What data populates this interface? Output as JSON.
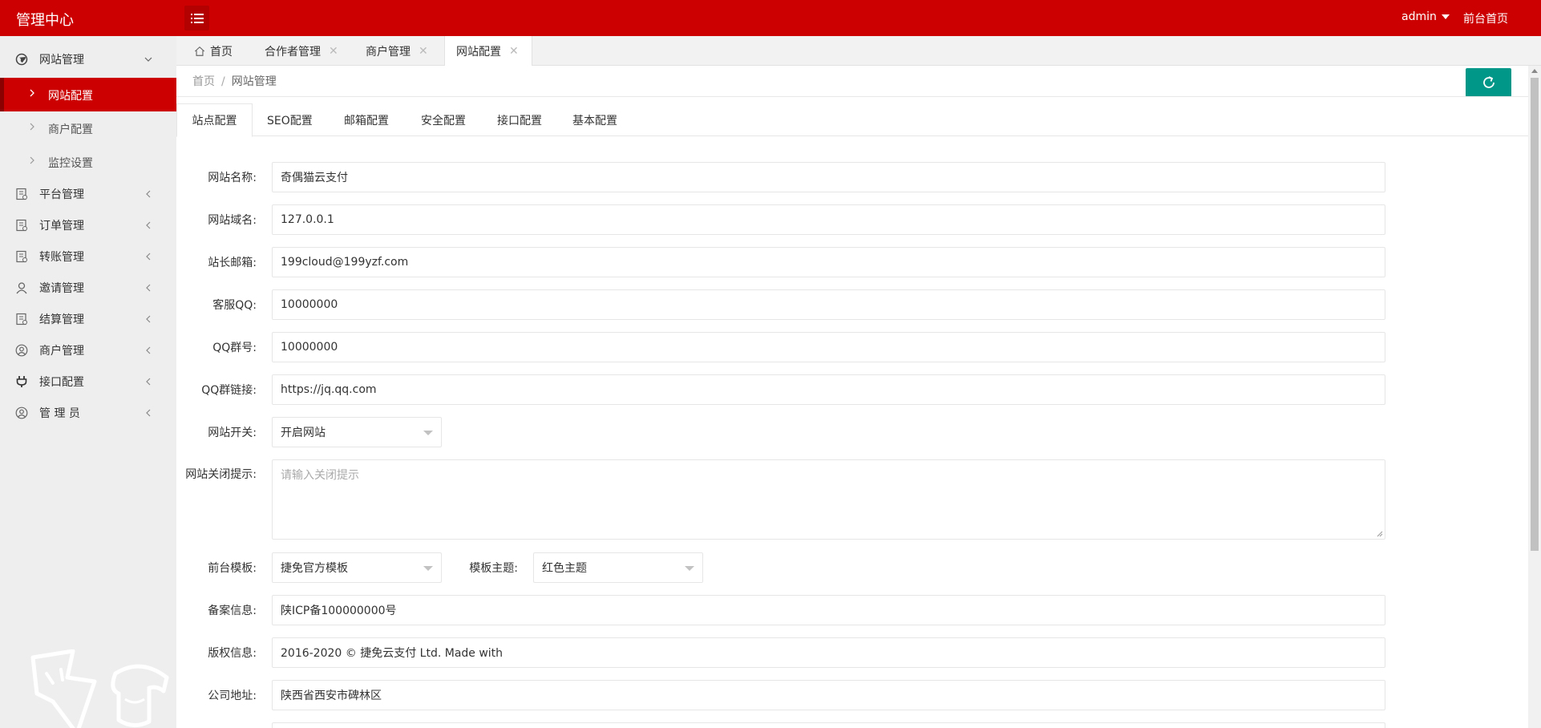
{
  "header": {
    "brand": "管理中心",
    "user": "admin",
    "front_link": "前台首页"
  },
  "sidebar": {
    "groups": [
      {
        "label": "网站管理",
        "icon": "globe-icon",
        "expanded": true
      },
      {
        "label": "平台管理",
        "icon": "document-icon"
      },
      {
        "label": "订单管理",
        "icon": "document-icon"
      },
      {
        "label": "转账管理",
        "icon": "document-icon"
      },
      {
        "label": "邀请管理",
        "icon": "user-icon"
      },
      {
        "label": "结算管理",
        "icon": "document-icon"
      },
      {
        "label": "商户管理",
        "icon": "user-circle-icon"
      },
      {
        "label": "接口配置",
        "icon": "plug-icon"
      },
      {
        "label": "管 理 员",
        "icon": "user-circle-icon"
      }
    ],
    "subitems": [
      {
        "label": "网站配置",
        "active": true
      },
      {
        "label": "商户配置"
      },
      {
        "label": "监控设置"
      }
    ]
  },
  "page_tabs": [
    {
      "label": "首页",
      "icon": "home-icon"
    },
    {
      "label": "合作者管理",
      "closable": true
    },
    {
      "label": "商户管理",
      "closable": true
    },
    {
      "label": "网站配置",
      "closable": true,
      "active": true
    }
  ],
  "breadcrumb": {
    "home": "首页",
    "separator": "/",
    "current": "网站管理"
  },
  "content_tabs": [
    "站点配置",
    "SEO配置",
    "邮箱配置",
    "安全配置",
    "接口配置",
    "基本配置"
  ],
  "form": {
    "site_name": {
      "label": "网站名称:",
      "value": "奇偶猫云支付"
    },
    "site_domain": {
      "label": "网站域名:",
      "value": "127.0.0.1"
    },
    "admin_email": {
      "label": "站长邮箱:",
      "value": "199cloud@199yzf.com"
    },
    "service_qq": {
      "label": "客服QQ:",
      "value": "10000000"
    },
    "qq_group": {
      "label": "QQ群号:",
      "value": "10000000"
    },
    "qq_group_link": {
      "label": "QQ群链接:",
      "value": "https://jq.qq.com"
    },
    "site_switch": {
      "label": "网站开关:",
      "value": "开启网站"
    },
    "close_notice": {
      "label": "网站关闭提示:",
      "placeholder": "请输入关闭提示"
    },
    "template": {
      "label": "前台模板:",
      "value": "捷免官方模板"
    },
    "theme": {
      "label": "模板主题:",
      "value": "红色主题"
    },
    "icp": {
      "label": "备案信息:",
      "value": "陕ICP备100000000号"
    },
    "copyright": {
      "label": "版权信息:",
      "value": "2016-2020 © 捷免云支付 Ltd.  Made with"
    },
    "address": {
      "label": "公司地址:",
      "value": "陕西省西安市碑林区"
    }
  },
  "colors": {
    "primary": "#cc0000",
    "refresh_button": "#009688"
  }
}
